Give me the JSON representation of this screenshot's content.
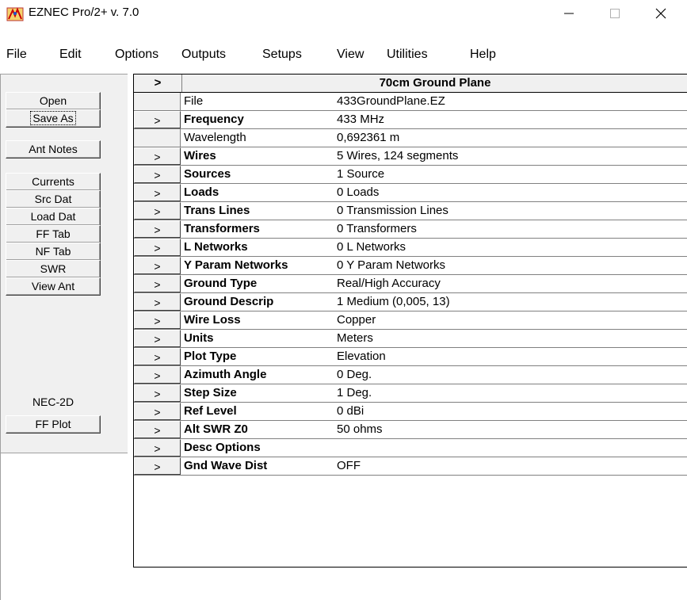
{
  "window": {
    "title": "EZNEC Pro/2+  v. 7.0",
    "minimize_glyph": "—",
    "maximize_glyph": "☐",
    "close_glyph": "✕"
  },
  "menu": [
    "File",
    "Edit",
    "Options",
    "Outputs",
    "Setups",
    "View",
    "Utilities",
    "Help"
  ],
  "left_buttons": {
    "open": "Open",
    "save_as": "Save As",
    "ant_notes": "Ant Notes",
    "currents": "Currents",
    "src_dat": "Src Dat",
    "load_dat": "Load Dat",
    "ff_tab": "FF Tab",
    "nf_tab": "NF Tab",
    "swr": "SWR",
    "view_ant": "View Ant",
    "engine_label": "NEC-2D",
    "ff_plot": "FF Plot"
  },
  "grid": {
    "header_arrow": ">",
    "title": "70cm Ground Plane",
    "rows": [
      {
        "arrow": "",
        "label": "File",
        "value": "433GroundPlane.EZ",
        "bold": false
      },
      {
        "arrow": ">",
        "label": "Frequency",
        "value": "433 MHz",
        "bold": true
      },
      {
        "arrow": "",
        "label": "Wavelength",
        "value": "0,692361 m",
        "bold": false
      },
      {
        "arrow": ">",
        "label": "Wires",
        "value": "5 Wires, 124 segments",
        "bold": true
      },
      {
        "arrow": ">",
        "label": "Sources",
        "value": "1 Source",
        "bold": true
      },
      {
        "arrow": ">",
        "label": "Loads",
        "value": "0 Loads",
        "bold": true
      },
      {
        "arrow": ">",
        "label": "Trans Lines",
        "value": "0 Transmission Lines",
        "bold": true
      },
      {
        "arrow": ">",
        "label": "Transformers",
        "value": "0 Transformers",
        "bold": true
      },
      {
        "arrow": ">",
        "label": "L Networks",
        "value": "0 L Networks",
        "bold": true
      },
      {
        "arrow": ">",
        "label": "Y Param Networks",
        "value": "0 Y Param Networks",
        "bold": true
      },
      {
        "arrow": ">",
        "label": "Ground Type",
        "value": "Real/High Accuracy",
        "bold": true
      },
      {
        "arrow": ">",
        "label": "Ground Descrip",
        "value": "1 Medium (0,005, 13)",
        "bold": true
      },
      {
        "arrow": ">",
        "label": "Wire Loss",
        "value": "Copper",
        "bold": true
      },
      {
        "arrow": ">",
        "label": "Units",
        "value": "Meters",
        "bold": true
      },
      {
        "arrow": ">",
        "label": "Plot Type",
        "value": "Elevation",
        "bold": true
      },
      {
        "arrow": ">",
        "label": "Azimuth Angle",
        "value": "0 Deg.",
        "bold": true
      },
      {
        "arrow": ">",
        "label": "Step Size",
        "value": "1 Deg.",
        "bold": true
      },
      {
        "arrow": ">",
        "label": "Ref Level",
        "value": "0 dBi",
        "bold": true
      },
      {
        "arrow": ">",
        "label": "Alt SWR Z0",
        "value": "50 ohms",
        "bold": true
      },
      {
        "arrow": ">",
        "label": "Desc Options",
        "value": "",
        "bold": true
      },
      {
        "arrow": ">",
        "label": "Gnd Wave Dist",
        "value": "OFF",
        "bold": true
      }
    ]
  }
}
